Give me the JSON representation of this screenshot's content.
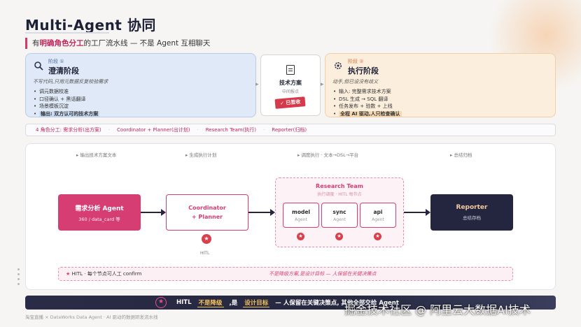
{
  "title": "Multi-Agent 协同",
  "subtitle": {
    "pre": "有",
    "emph": "明确角色分工",
    "post": "的工厂流水线 — 不是 Agent 互相聊天"
  },
  "left_phase": {
    "icon": "search-icon",
    "tag": "阶段 ①",
    "name": "澄清阶段",
    "desc": "不写代码,只用元数据反复校验需求",
    "items": [
      "调元数据校准",
      "口径确认 + 黑话翻译",
      "场景模板沉淀",
      "输出: 双方认可的技术方案"
    ]
  },
  "center_card": {
    "icon": "document-icon",
    "title": "技术方案",
    "sub": "中间报点",
    "stamp": "✓ 已签收"
  },
  "right_phase": {
    "icon": "gear-icon",
    "tag": "阶段 ②",
    "name": "执行阶段",
    "desc": "动手,但已设没有歧义",
    "items": [
      "输入: 完整需求技术方案",
      "DSL 生成 → SQL 翻译",
      "任务发布 + 验数 + 上线",
      "全程 AI 驱动,人只检查确认"
    ]
  },
  "roles_bar": {
    "prefix": "4 角色分工: 需求分析(出方案)",
    "r2": "Coordinator + Planner(出计划)",
    "r3": "Research Team(执行)",
    "r4": "Reporter(归档)",
    "sep": "·"
  },
  "steps": [
    "▸ 输出技术方案文本",
    "▸ 生成执行计划",
    "▸ 调度执行 · 文本→DSL→平台",
    "▸ 总结归档"
  ],
  "nodes": {
    "requirement": {
      "title": "需求分析 Agent",
      "sub": "360 / data_card 等"
    },
    "coordinator": {
      "line1": "Coordinator",
      "line2": "+ Planner"
    },
    "research_team": {
      "title": "Research Team",
      "sub": "执行调度 · HITL 每节点"
    },
    "agents": [
      {
        "title": "model",
        "sub": "Agent"
      },
      {
        "title": "sync",
        "sub": "Agent"
      },
      {
        "title": "api",
        "sub": "Agent"
      }
    ],
    "reporter": {
      "title": "Reporter",
      "sub": "总结存档"
    },
    "hitl_label": "HITL"
  },
  "hitl_bar": {
    "star": "★",
    "text": "HITL · 每个节点可人工 confirm",
    "emph": "不是降级方案,是设计目标 — 人保留在关键决策点"
  },
  "banner": {
    "star": "★",
    "p1": "HITL",
    "hl1": "不是降级",
    "p2": ",是",
    "hl2": "设计目标",
    "p3": "— 人保留在关键决策点, 其他全部交给 Agent"
  },
  "footer": "淘宝直播 × DataWorks Data Agent · AI 驱动的数据研发流水线",
  "watermark": "掘金技术社区 @ 阿里云大数据AI技术",
  "colors": {
    "accent": "#d63d72",
    "dark": "#24263f",
    "left_bg": "#dfe9f7",
    "right_bg": "#fbeedd"
  }
}
